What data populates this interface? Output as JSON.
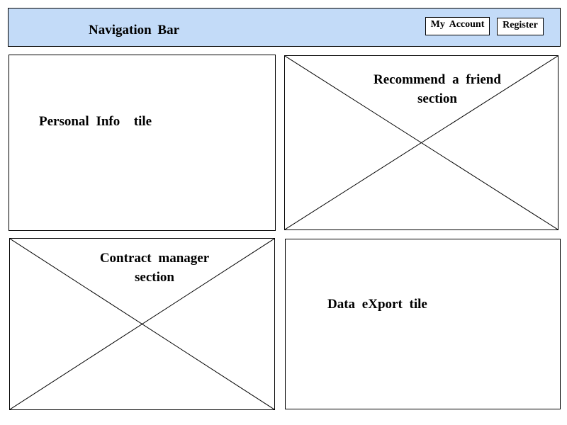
{
  "navbar": {
    "title": "Navigation Bar",
    "background_color": "#c3dbf8",
    "buttons": {
      "my_account": "My Account",
      "register": "Register"
    }
  },
  "tiles": {
    "personal_info": {
      "label": "Personal Info  tile"
    },
    "recommend_friend": {
      "label_line1": "Recommend a friend",
      "label_line2": "section",
      "placeholder": true
    },
    "contract_manager": {
      "label_line1": "Contract manager",
      "label_line2": "section",
      "placeholder": true
    },
    "data_export": {
      "label": "Data eXport tile"
    }
  }
}
